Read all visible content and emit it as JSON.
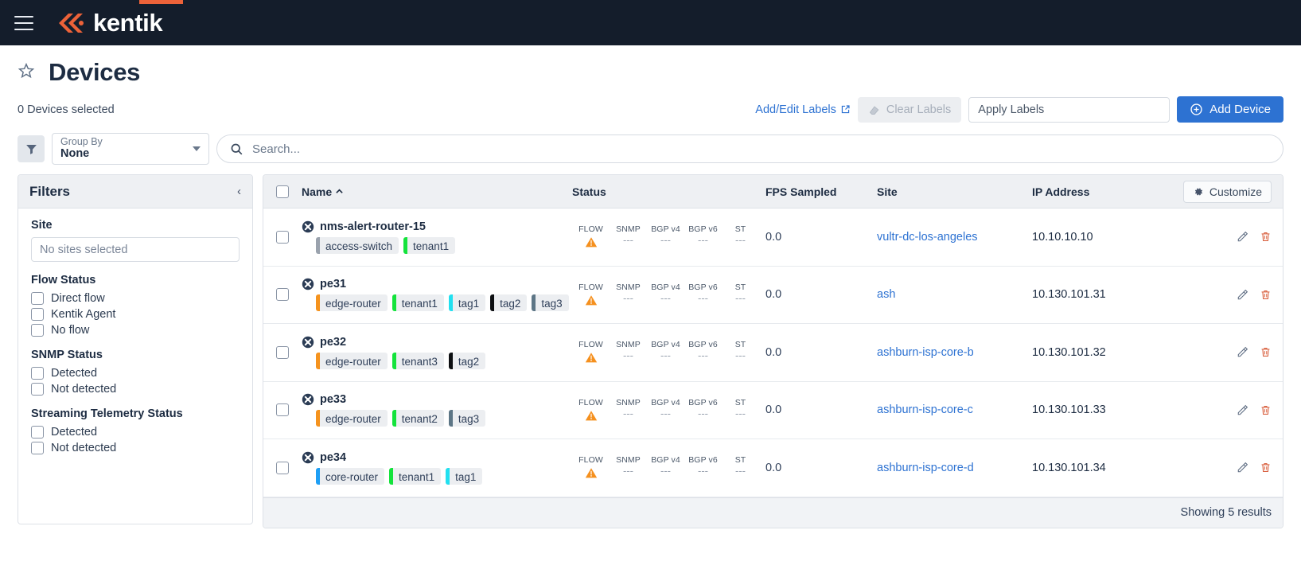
{
  "app": {
    "brand": "kentik",
    "menu_icon": "hamburger-icon"
  },
  "page": {
    "title": "Devices",
    "selected_count_text": "0 Devices selected"
  },
  "toolbar": {
    "add_edit_labels": "Add/Edit Labels",
    "clear_labels": "Clear Labels",
    "apply_labels_placeholder": "Apply Labels",
    "apply_labels_value": "",
    "add_device": "Add Device"
  },
  "filterbar": {
    "group_by_label": "Group By",
    "group_by_value": "None",
    "search_placeholder": "Search...",
    "search_value": ""
  },
  "filters": {
    "title": "Filters",
    "collapse_icon": "chevron-left-icon",
    "groups": [
      {
        "title": "Site",
        "type": "select",
        "placeholder": "No sites selected"
      },
      {
        "title": "Flow Status",
        "type": "checkboxes",
        "options": [
          "Direct flow",
          "Kentik Agent",
          "No flow"
        ]
      },
      {
        "title": "SNMP Status",
        "type": "checkboxes",
        "options": [
          "Detected",
          "Not detected"
        ]
      },
      {
        "title": "Streaming Telemetry Status",
        "type": "checkboxes",
        "options": [
          "Detected",
          "Not detected"
        ]
      }
    ]
  },
  "table": {
    "columns": {
      "name": "Name",
      "name_sort": "˄",
      "status": "Status",
      "fps": "FPS Sampled",
      "site": "Site",
      "ip": "IP Address"
    },
    "customize_label": "Customize",
    "status_labels": [
      "FLOW",
      "SNMP",
      "BGP v4",
      "BGP v6",
      "ST"
    ],
    "footer": "Showing 5 results",
    "rows": [
      {
        "name": "nms-alert-router-15",
        "tags": [
          {
            "label": "access-switch",
            "color": "#9aa2ad"
          },
          {
            "label": "tenant1",
            "color": "#14e33c"
          }
        ],
        "status": [
          "warning",
          "---",
          "---",
          "---",
          "---"
        ],
        "fps": "0.0",
        "site": "vultr-dc-los-angeles",
        "ip": "10.10.10.10"
      },
      {
        "name": "pe31",
        "tags": [
          {
            "label": "edge-router",
            "color": "#f5931e"
          },
          {
            "label": "tenant1",
            "color": "#14e33c"
          },
          {
            "label": "tag1",
            "color": "#22e0f0"
          },
          {
            "label": "tag2",
            "color": "#0d0f12"
          },
          {
            "label": "tag3",
            "color": "#5d7686"
          }
        ],
        "status": [
          "warning",
          "---",
          "---",
          "---",
          "---"
        ],
        "fps": "0.0",
        "site": "ash",
        "ip": "10.130.101.31"
      },
      {
        "name": "pe32",
        "tags": [
          {
            "label": "edge-router",
            "color": "#f5931e"
          },
          {
            "label": "tenant3",
            "color": "#14e33c"
          },
          {
            "label": "tag2",
            "color": "#0d0f12"
          }
        ],
        "status": [
          "warning",
          "---",
          "---",
          "---",
          "---"
        ],
        "fps": "0.0",
        "site": "ashburn-isp-core-b",
        "ip": "10.130.101.32"
      },
      {
        "name": "pe33",
        "tags": [
          {
            "label": "edge-router",
            "color": "#f5931e"
          },
          {
            "label": "tenant2",
            "color": "#14e33c"
          },
          {
            "label": "tag3",
            "color": "#5d7686"
          }
        ],
        "status": [
          "warning",
          "---",
          "---",
          "---",
          "---"
        ],
        "fps": "0.0",
        "site": "ashburn-isp-core-c",
        "ip": "10.130.101.33"
      },
      {
        "name": "pe34",
        "tags": [
          {
            "label": "core-router",
            "color": "#1e9ff5"
          },
          {
            "label": "tenant1",
            "color": "#14e33c"
          },
          {
            "label": "tag1",
            "color": "#22e0f0"
          }
        ],
        "status": [
          "warning",
          "---",
          "---",
          "---",
          "---"
        ],
        "fps": "0.0",
        "site": "ashburn-isp-core-d",
        "ip": "10.130.101.34"
      }
    ]
  },
  "colors": {
    "brand_orange": "#ec6239",
    "navbar": "#141d2b",
    "accent_blue": "#2d72d2",
    "warning": "#f5901e"
  }
}
